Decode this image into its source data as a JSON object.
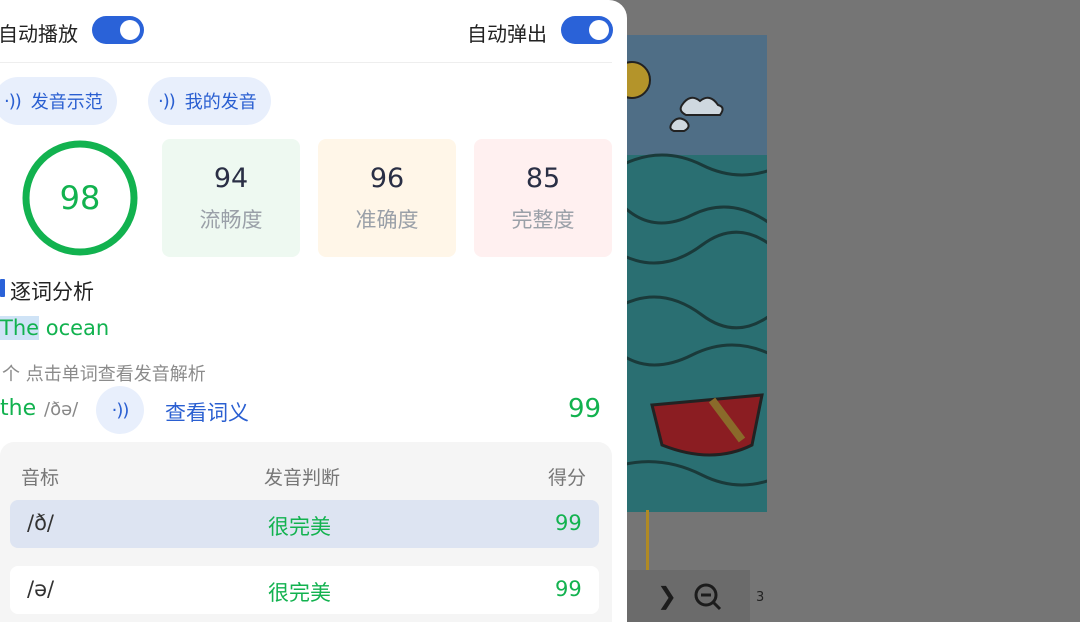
{
  "toggles": {
    "auto_play": {
      "label": "自动播放",
      "on": true
    },
    "auto_popup": {
      "label": "自动弹出",
      "on": true
    }
  },
  "audio_buttons": {
    "demo": "发音示范",
    "mine": "我的发音"
  },
  "score": {
    "overall": "98",
    "metrics": [
      {
        "value": "94",
        "label": "流畅度",
        "bg": "#eef9f1"
      },
      {
        "value": "96",
        "label": "准确度",
        "bg": "#fff6e8"
      },
      {
        "value": "85",
        "label": "完整度",
        "bg": "#fff0f0"
      }
    ]
  },
  "analysis": {
    "title": "逐词分析",
    "sentence_word_1": "The",
    "sentence_word_2": " ocean",
    "hint": "个 点击单词查看发音解析",
    "selected_word": "the",
    "selected_ipa": "/ðə/",
    "view_definition": "查看词义",
    "word_score": "99"
  },
  "phoneme_table": {
    "headers": {
      "phoneme": "音标",
      "judgement": "发音判断",
      "score": "得分"
    },
    "rows": [
      {
        "phoneme": "/ð/",
        "judgement": "很完美",
        "score": "99",
        "highlighted": true
      },
      {
        "phoneme": "/ə/",
        "judgement": "很完美",
        "score": "99",
        "highlighted": false
      }
    ]
  },
  "reader": {
    "page_number": "3"
  },
  "colors": {
    "accent_blue": "#2a62d8",
    "success_green": "#12b24f",
    "overlay": "#757575"
  }
}
